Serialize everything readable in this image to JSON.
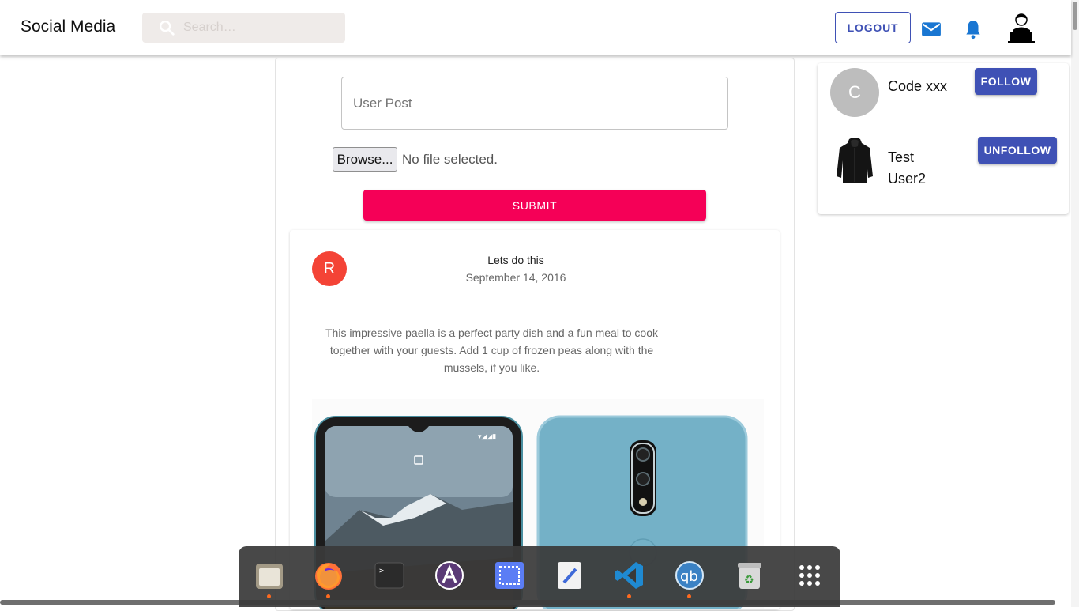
{
  "header": {
    "brand": "Social Media",
    "search_placeholder": "Search…",
    "logout_label": "LOGOUT"
  },
  "composer": {
    "post_placeholder": "User Post",
    "browse_label": "Browse...",
    "no_file_text": "No file selected.",
    "submit_label": "SUBMIT"
  },
  "post": {
    "avatar_letter": "R",
    "title": "Lets do this",
    "date": "September 14, 2016",
    "body": "This impressive paella is a perfect party dish and a fun meal to cook together with your guests. Add 1 cup of frozen peas along with the mussels, if you like."
  },
  "suggestions": [
    {
      "avatar_letter": "C",
      "name": "Code xxx",
      "action": "FOLLOW"
    },
    {
      "name": "Test User2",
      "action": "UNFOLLOW"
    }
  ],
  "dock": {
    "items": [
      "files-icon",
      "firefox-icon",
      "terminal-icon",
      "app-store-icon",
      "screenshot-icon",
      "text-editor-icon",
      "vscode-icon",
      "qbittorrent-icon",
      "trash-icon",
      "app-grid-icon"
    ]
  },
  "colors": {
    "primary": "#3f51b5",
    "secondary": "#f50057",
    "post_avatar": "#f44336",
    "accent_blue": "#1976d2"
  }
}
